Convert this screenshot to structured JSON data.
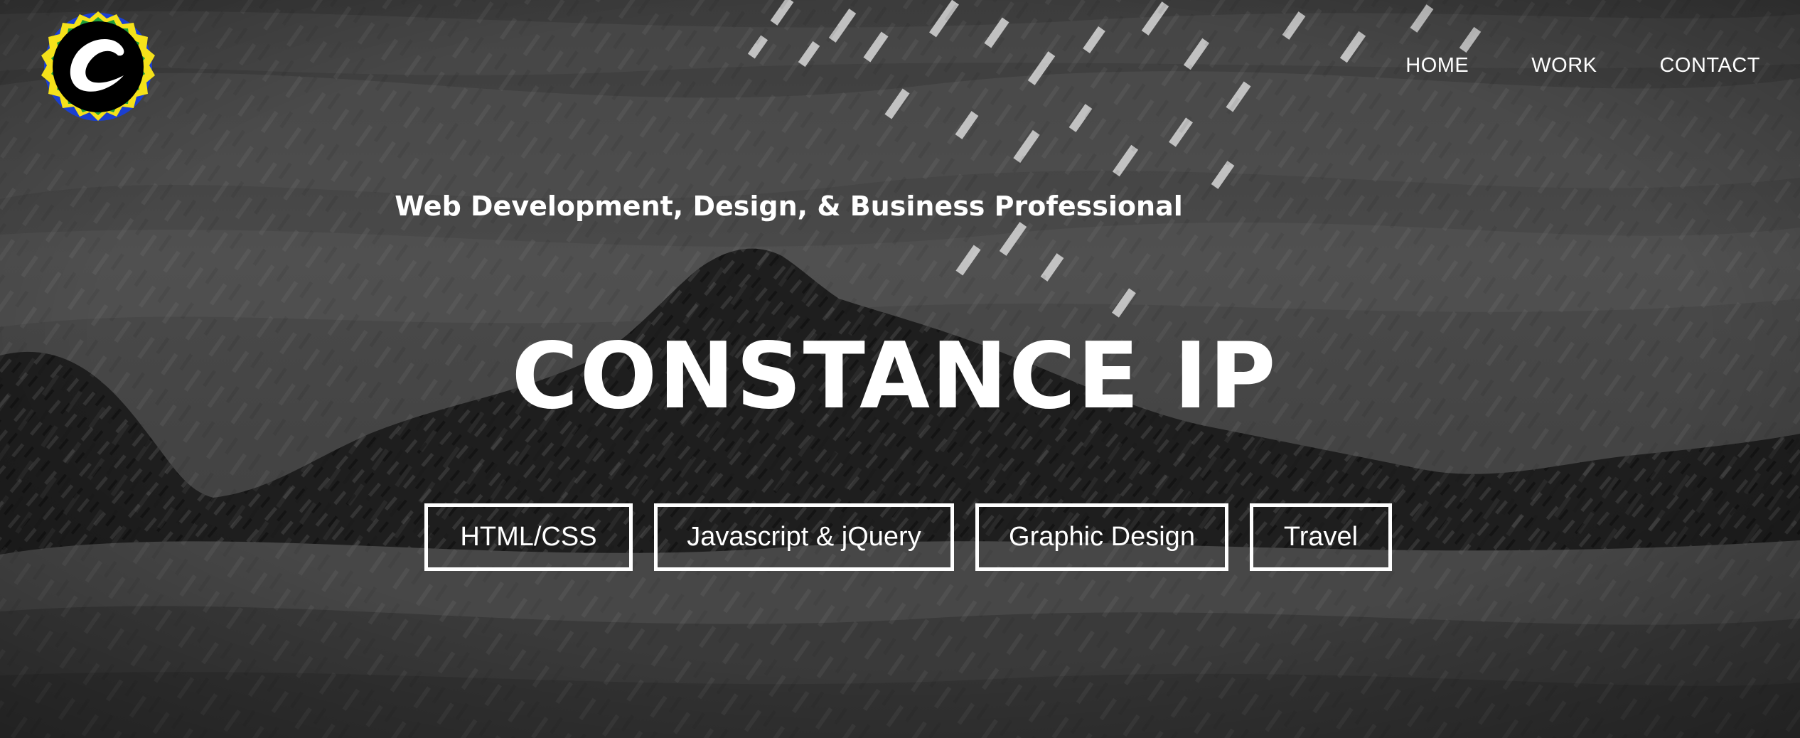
{
  "logo": {
    "letter": "C",
    "ring_colors": [
      "#1a3fd1",
      "#f5e11a",
      "#1e9e3a"
    ]
  },
  "nav": {
    "items": [
      {
        "label": "HOME"
      },
      {
        "label": "WORK"
      },
      {
        "label": "CONTACT"
      }
    ]
  },
  "hero": {
    "subtitle": "Web Development, Design, & Business Professional",
    "title": "CONSTANCE IP",
    "tags": [
      {
        "label": "HTML/CSS"
      },
      {
        "label": "Javascript & jQuery"
      },
      {
        "label": "Graphic Design"
      },
      {
        "label": "Travel"
      }
    ]
  },
  "colors": {
    "text": "#ffffff",
    "background": "#3a3a3a"
  }
}
